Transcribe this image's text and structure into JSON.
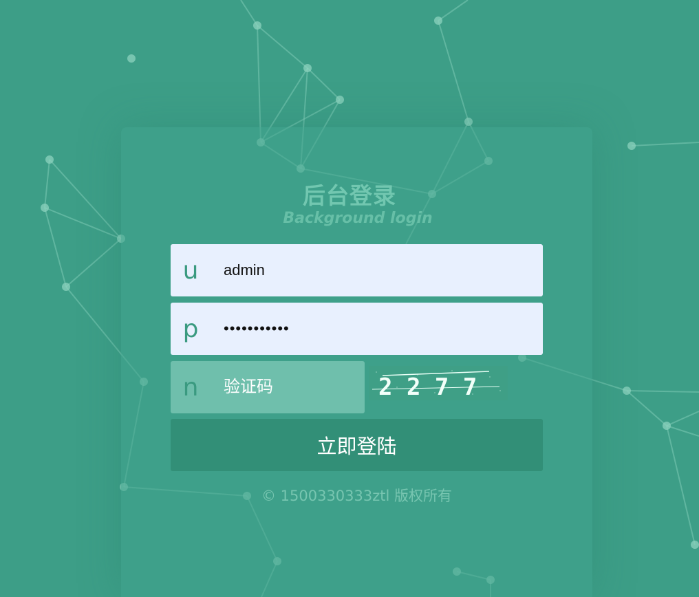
{
  "page": {
    "background_color": "#3d9e87",
    "card_color": "#40a28c",
    "accent_color": "#3a9a80",
    "button_color": "#328f77"
  },
  "header": {
    "title": "后台登录",
    "subtitle": "Background login"
  },
  "form": {
    "username": {
      "prefix": "u",
      "value": "admin"
    },
    "password": {
      "prefix": "p",
      "value": "•••••••••••"
    },
    "captcha": {
      "prefix": "n",
      "placeholder": "验证码",
      "image_text": "2 2 7 7"
    },
    "submit_label": "立即登陆"
  },
  "footer": {
    "copyright": "© 1500330333ztl 版权所有"
  }
}
